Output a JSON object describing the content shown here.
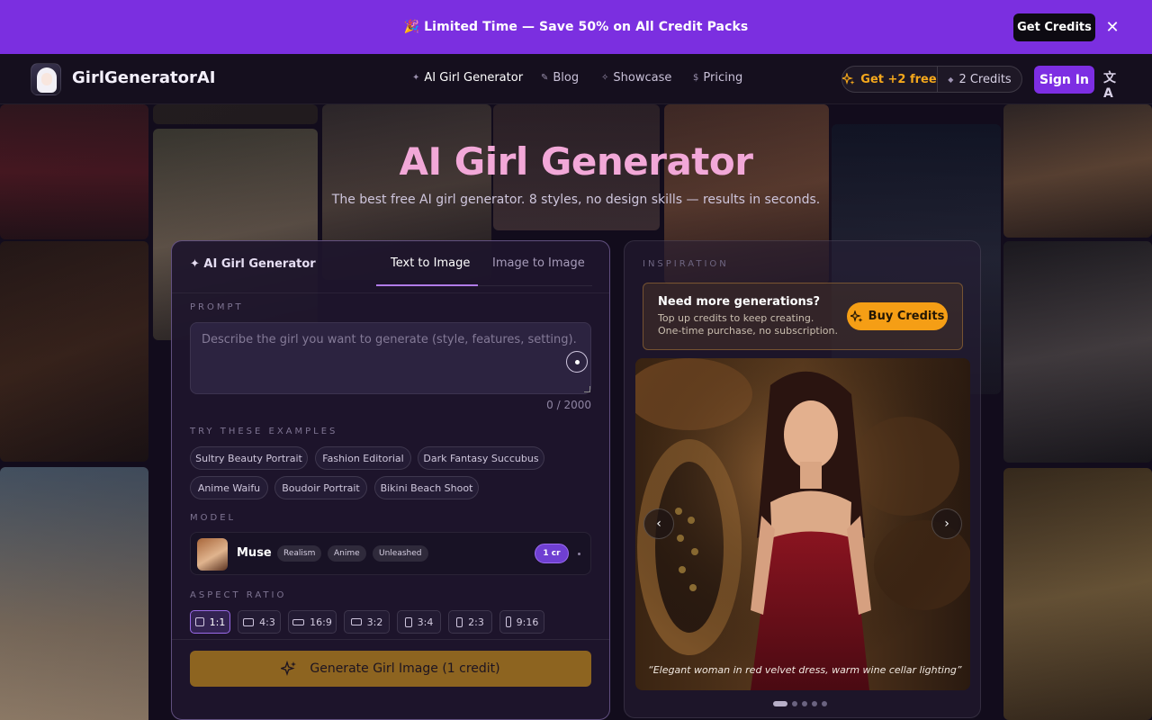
{
  "promo": {
    "text": "🎉 Limited Time — Save 50% on All Credit Packs",
    "button": "Get Credits",
    "close": "✕"
  },
  "header": {
    "logo_text": "GirlGeneratorAI",
    "nav": [
      {
        "icon": "✦",
        "label": "AI Girl Generator"
      },
      {
        "icon": "✎",
        "label": "Blog"
      },
      {
        "icon": "✧",
        "label": "Showcase"
      },
      {
        "icon": "$",
        "label": "Pricing"
      }
    ],
    "free_label": "Get +2 free",
    "credits_label": "2 Credits",
    "signin": "Sign In",
    "translate_icon": "文A"
  },
  "hero": {
    "title": "AI Girl Generator",
    "subtitle": "The best free AI girl generator. 8 styles, no design skills — results in seconds."
  },
  "generator": {
    "title": "✦ AI Girl Generator",
    "tabs": [
      "Text to Image",
      "Image to Image"
    ],
    "prompt_label": "PROMPT",
    "prompt_placeholder": "Describe the girl you want to generate (style, features, setting).",
    "counter": "0 / 2000",
    "examples_label": "TRY THESE EXAMPLES",
    "examples": [
      "Sultry Beauty Portrait",
      "Fashion Editorial",
      "Dark Fantasy Succubus",
      "Anime Waifu",
      "Boudoir Portrait",
      "Bikini Beach Shoot"
    ],
    "model_label": "MODEL",
    "model": {
      "name": "Muse",
      "tags": [
        "Realism",
        "Anime",
        "Unleashed"
      ],
      "cost": "1 cr"
    },
    "ratio_label": "ASPECT RATIO",
    "ratios": [
      "1:1",
      "4:3",
      "16:9",
      "3:2",
      "3:4",
      "2:3",
      "9:16"
    ],
    "selected_ratio": "1:1",
    "generate": "Generate Girl Image (1 credit)"
  },
  "inspiration": {
    "label": "INSPIRATION",
    "card_title": "Need more generations?",
    "card_desc": "Top up credits to keep creating. One-time purchase, no subscription.",
    "buy": "Buy Credits",
    "caption": "“Elegant woman in red velvet dress, warm wine cellar lighting”",
    "prev": "‹",
    "next": "›",
    "slides": 5,
    "active_slide": 0
  },
  "colors": {
    "accent": "#7b2fe0",
    "title_pink": "#f2a8d8",
    "gold": "#f59e15"
  }
}
